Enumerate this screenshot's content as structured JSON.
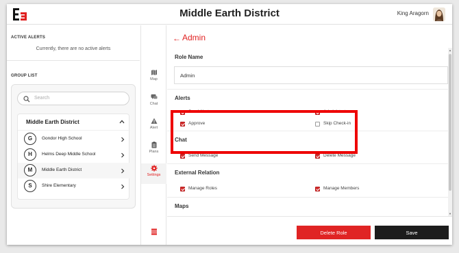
{
  "header": {
    "title": "Middle Earth District",
    "user_name": "King Aragorn"
  },
  "left": {
    "active_alerts_label": "ACTIVE ALERTS",
    "no_alerts_text": "Currently, there are no active alerts",
    "group_list_label": "GROUP LIST",
    "search_placeholder": "Search",
    "district": "Middle Earth District",
    "schools": [
      {
        "initial": "G",
        "name": "Gondor High School"
      },
      {
        "initial": "H",
        "name": "Helms Deep Middle School"
      },
      {
        "initial": "M",
        "name": "Middle Earth District"
      },
      {
        "initial": "S",
        "name": "Shire Elementary"
      }
    ]
  },
  "nav": {
    "items": [
      {
        "label": "Map",
        "icon": "map-icon"
      },
      {
        "label": "Chat",
        "icon": "chat-icon"
      },
      {
        "label": "Alert",
        "icon": "alert-icon"
      },
      {
        "label": "Plans",
        "icon": "clipboard-icon"
      },
      {
        "label": "Settings",
        "icon": "gear-icon",
        "active": true
      }
    ]
  },
  "main": {
    "back_arrow": "←",
    "title": "Admin",
    "role_name_label": "Role Name",
    "role_name_value": "Admin",
    "groups": [
      {
        "title": "Alerts",
        "perms": [
          {
            "label": "Send Alerts",
            "checked": true
          },
          {
            "label": "Administrate",
            "checked": true
          },
          {
            "label": "Approve",
            "checked": true
          },
          {
            "label": "Skip Check-in",
            "checked": false
          }
        ]
      },
      {
        "title": "Chat",
        "perms": [
          {
            "label": "Send Message",
            "checked": true
          },
          {
            "label": "Delete Message",
            "checked": true
          }
        ]
      },
      {
        "title": "External Relation",
        "perms": [
          {
            "label": "Manage Roles",
            "checked": true
          },
          {
            "label": "Manage Members",
            "checked": true
          }
        ]
      },
      {
        "title": "Maps",
        "perms": []
      }
    ],
    "delete_label": "Delete Role",
    "save_label": "Save"
  },
  "colors": {
    "accent": "#e02020",
    "highlight": "#ee0000",
    "save_button": "#1c1c1c"
  }
}
